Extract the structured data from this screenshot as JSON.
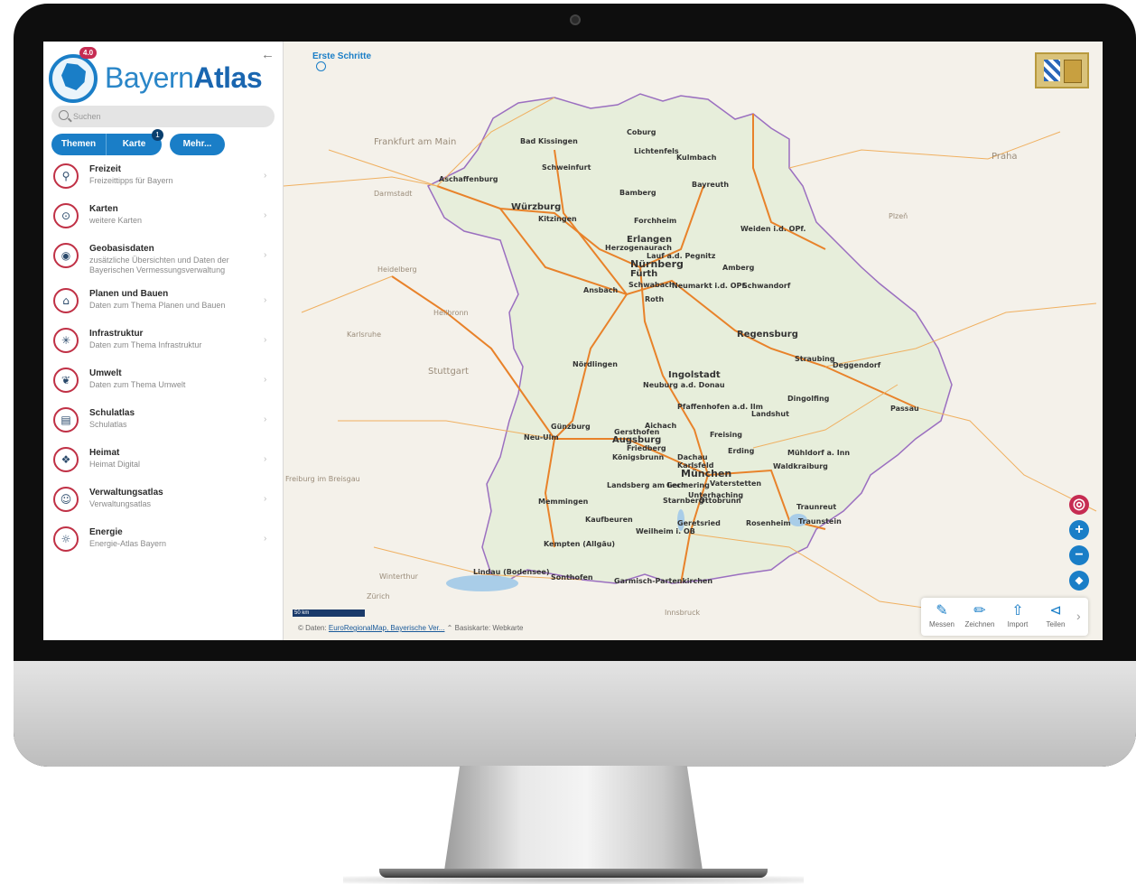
{
  "app": {
    "logo_badge": "4.0",
    "logo_text_light": "Bayern",
    "logo_text_bold": "Atlas"
  },
  "sidebar": {
    "collapse_icon": "arrow-left-icon",
    "search": {
      "placeholder": "Suchen",
      "value": ""
    },
    "tabs": [
      {
        "label": "Themen"
      },
      {
        "label": "Karte"
      }
    ],
    "karte_badge": "1",
    "mehr_label": "Mehr...",
    "items": [
      {
        "title": "Freizeit",
        "subtitle": "Freizeittipps für Bayern",
        "icon": "hiker-icon"
      },
      {
        "title": "Karten",
        "subtitle": "weitere Karten",
        "icon": "map-pin-icon"
      },
      {
        "title": "Geobasisdaten",
        "subtitle": "zusätzliche Übersichten und Daten der Bayerischen Vermessungsverwaltung",
        "icon": "location-icon"
      },
      {
        "title": "Planen und Bauen",
        "subtitle": "Daten zum Thema Planen und Bauen",
        "icon": "buildings-icon"
      },
      {
        "title": "Infrastruktur",
        "subtitle": "Daten zum Thema Infrastruktur",
        "icon": "network-icon"
      },
      {
        "title": "Umwelt",
        "subtitle": "Daten zum Thema Umwelt",
        "icon": "leaf-icon"
      },
      {
        "title": "Schulatlas",
        "subtitle": "Schulatlas",
        "icon": "book-icon"
      },
      {
        "title": "Heimat",
        "subtitle": "Heimat Digital",
        "icon": "diamond-pattern-icon"
      },
      {
        "title": "Verwaltungsatlas",
        "subtitle": "Verwaltungsatlas",
        "icon": "people-icon"
      },
      {
        "title": "Energie",
        "subtitle": "Energie-Atlas Bayern",
        "icon": "bulb-icon"
      }
    ]
  },
  "map": {
    "erste_schritte": "Erste Schritte",
    "scale_label": "50 km",
    "attribution_prefix": "© Daten:",
    "attribution_link": "EuroRegionalMap, Bayerische Ver...",
    "basemap_label": "Basiskarte: Webkarte",
    "tools": [
      {
        "label": "Messen",
        "icon": "ruler-icon"
      },
      {
        "label": "Zeichnen",
        "icon": "pencil-icon"
      },
      {
        "label": "Import",
        "icon": "upload-icon"
      },
      {
        "label": "Teilen",
        "icon": "share-icon"
      }
    ],
    "cities": [
      {
        "name": "Bad Kissingen"
      },
      {
        "name": "Coburg"
      },
      {
        "name": "Lichtenfels"
      },
      {
        "name": "Kulmbach"
      },
      {
        "name": "Schweinfurt"
      },
      {
        "name": "Bayreuth"
      },
      {
        "name": "Bamberg"
      },
      {
        "name": "Aschaffenburg"
      },
      {
        "name": "Würzburg"
      },
      {
        "name": "Kitzingen"
      },
      {
        "name": "Forchheim"
      },
      {
        "name": "Weiden i.d. OPf."
      },
      {
        "name": "Erlangen"
      },
      {
        "name": "Herzogenaurach"
      },
      {
        "name": "Lauf a.d. Pegnitz"
      },
      {
        "name": "Nürnberg"
      },
      {
        "name": "Fürth"
      },
      {
        "name": "Amberg"
      },
      {
        "name": "Schwabach"
      },
      {
        "name": "Neumarkt i.d. OPf."
      },
      {
        "name": "Schwandorf"
      },
      {
        "name": "Ansbach"
      },
      {
        "name": "Roth"
      },
      {
        "name": "Regensburg"
      },
      {
        "name": "Straubing"
      },
      {
        "name": "Deggendorf"
      },
      {
        "name": "Nördlingen"
      },
      {
        "name": "Ingolstadt"
      },
      {
        "name": "Neuburg a.d. Donau"
      },
      {
        "name": "Dingolfing"
      },
      {
        "name": "Passau"
      },
      {
        "name": "Pfaffenhofen a.d. Ilm"
      },
      {
        "name": "Landshut"
      },
      {
        "name": "Günzburg"
      },
      {
        "name": "Aichach"
      },
      {
        "name": "Gersthofen"
      },
      {
        "name": "Augsburg"
      },
      {
        "name": "Neu-Ulm"
      },
      {
        "name": "Friedberg"
      },
      {
        "name": "Freising"
      },
      {
        "name": "Königsbrunn"
      },
      {
        "name": "Erding"
      },
      {
        "name": "Mühldorf a. Inn"
      },
      {
        "name": "Dachau"
      },
      {
        "name": "Karlsfeld"
      },
      {
        "name": "Waldkraiburg"
      },
      {
        "name": "München"
      },
      {
        "name": "Germering"
      },
      {
        "name": "Vaterstetten"
      },
      {
        "name": "Landsberg am Lech"
      },
      {
        "name": "Unterhaching"
      },
      {
        "name": "Starnberg"
      },
      {
        "name": "Ottobrunn"
      },
      {
        "name": "Memmingen"
      },
      {
        "name": "Traunreut"
      },
      {
        "name": "Kaufbeuren"
      },
      {
        "name": "Traunstein"
      },
      {
        "name": "Geretsried"
      },
      {
        "name": "Rosenheim"
      },
      {
        "name": "Weilheim i. OB"
      },
      {
        "name": "Kempten (Allgäu)"
      },
      {
        "name": "Lindau (Bodensee)"
      },
      {
        "name": "Sonthofen"
      },
      {
        "name": "Garmisch-Partenkirchen"
      },
      {
        "name": "Praha"
      },
      {
        "name": "Plzeň"
      },
      {
        "name": "Frankfurt am Main"
      },
      {
        "name": "Darmstadt"
      },
      {
        "name": "Stuttgart"
      },
      {
        "name": "Karlsruhe"
      },
      {
        "name": "Heilbronn"
      },
      {
        "name": "Heidelberg"
      },
      {
        "name": "Zürich"
      },
      {
        "name": "Winterthur"
      },
      {
        "name": "Freiburg im Breisgau"
      },
      {
        "name": "Innsbruck"
      }
    ]
  },
  "colors": {
    "accent": "#1a7ec7",
    "badge": "#c62c52",
    "road_major": "#e8822a",
    "road_minor": "#f0b060",
    "bavaria_fill": "#e7eedb",
    "border": "#9b6fc0"
  }
}
